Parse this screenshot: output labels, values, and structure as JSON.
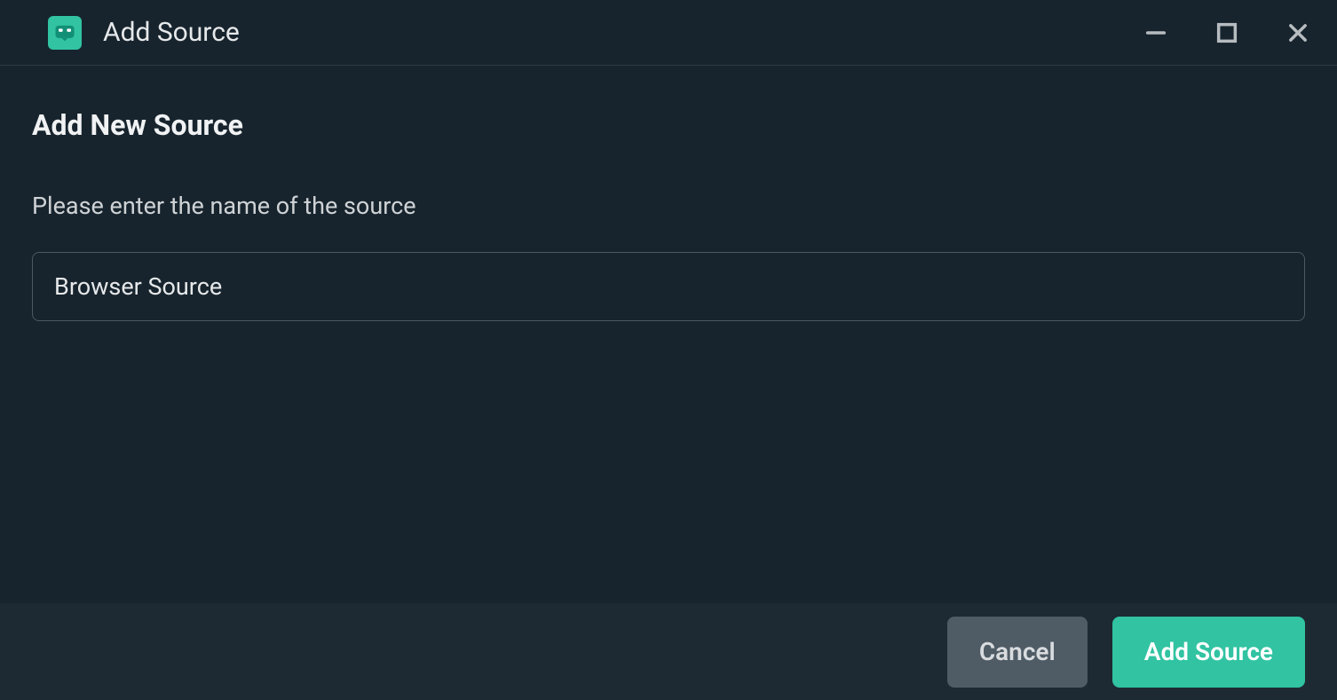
{
  "window": {
    "title": "Add Source"
  },
  "dialog": {
    "heading": "Add New Source",
    "prompt": "Please enter the name of the source",
    "input_value": "Browser Source"
  },
  "footer": {
    "cancel_label": "Cancel",
    "submit_label": "Add Source"
  },
  "colors": {
    "accent": "#31c3a2",
    "bg": "#17242d",
    "footer_bg": "#1d2a33"
  }
}
